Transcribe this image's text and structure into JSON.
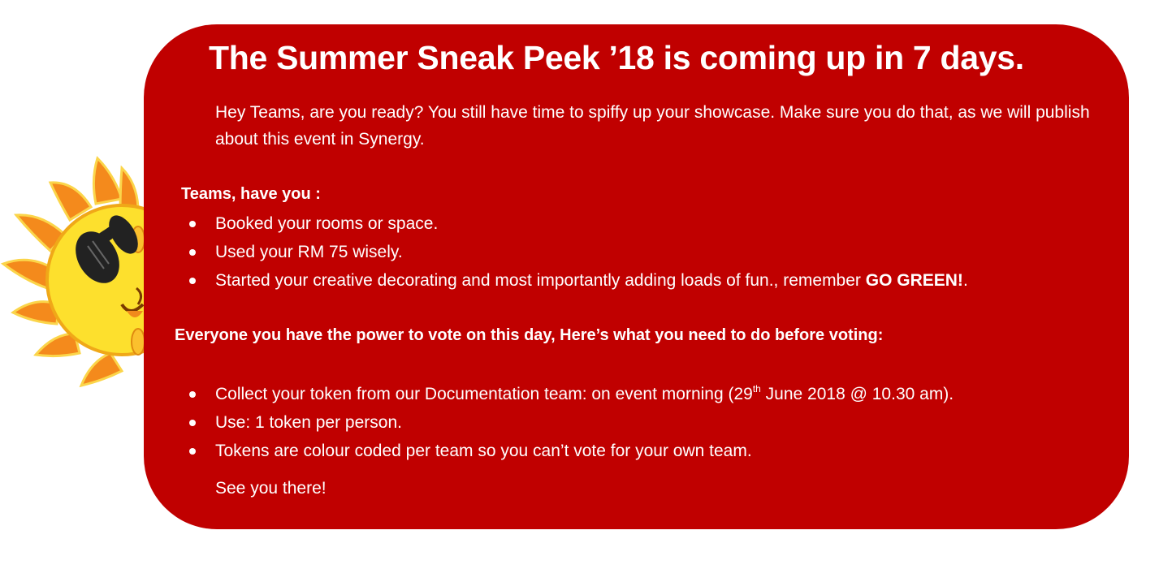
{
  "title": "The Summer Sneak Peek ’18 is coming up in 7 days.",
  "intro": "Hey Teams, are you ready? You still have time to spiffy up your showcase. Make sure you do that, as we will publish about this event in Synergy.",
  "teams_section": {
    "heading": "Teams, have you :",
    "items": [
      "Booked your rooms or space.",
      "Used your RM 75 wisely."
    ],
    "item3_text": "Started your creative decorating and most importantly adding loads of fun., remember ",
    "item3_bold": "GO GREEN!",
    "item3_end": "."
  },
  "voting_section": {
    "heading": "Everyone you have the power to vote on this day, Here’s what you need to do before voting:",
    "item1_text": "Collect your token from our Documentation team: on event morning (29",
    "item1_sup": "th",
    "item1_end": " June 2018 @ 10.30 am).",
    "items": [
      "Use: 1 token per person.",
      "Tokens are colour coded per team so you can’t vote for your own team."
    ]
  },
  "closing": "See you there!",
  "colors": {
    "card_background": "#c00000",
    "text": "#ffffff",
    "sun_face": "#fde02d",
    "sun_rays": "#f48a1c"
  },
  "icons": {
    "sun": "sun-with-sunglasses-icon"
  }
}
